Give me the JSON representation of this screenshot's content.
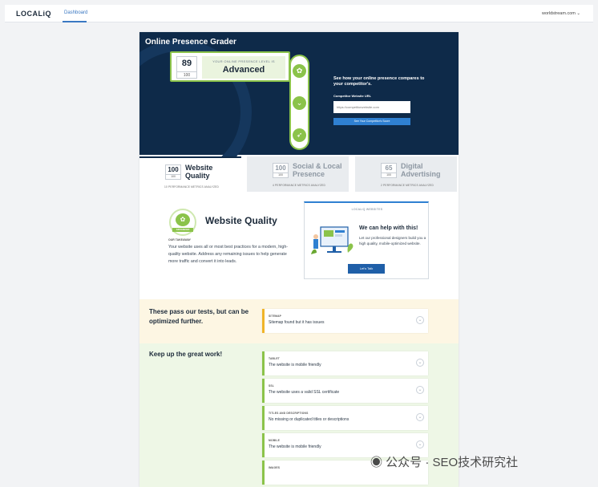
{
  "topbar": {
    "logo": "LOCALiQ",
    "nav_tab": "Dashboard",
    "account": "worldstream.com"
  },
  "hero": {
    "title": "Online Presence Grader",
    "score": "89",
    "score_out_of": "100",
    "level_caption": "YOUR ONLINE PRESENCE LEVEL IS",
    "level": "Advanced",
    "compare_text": "See how your online presence compares to your competitor's.",
    "url_label": "Competitor Website URL",
    "url_placeholder": "https://competitorwebsite.com",
    "compare_button": "See Your Competitor's Score"
  },
  "categories": [
    {
      "score": "100",
      "out_of": "100",
      "name": "Website Quality",
      "metrics": "10 PERFORMANCE METRICS ANALYZED"
    },
    {
      "score": "100",
      "out_of": "100",
      "name": "Social & Local Presence",
      "metrics": "4 PERFORMANCE METRICS ANALYZED"
    },
    {
      "score": "65",
      "out_of": "100",
      "name": "Digital Advertising",
      "metrics": "2 PERFORMANCE METRICS ANALYZED"
    }
  ],
  "website_quality": {
    "badge": "ADVANCED",
    "title": "Website Quality",
    "caption": "OUR TAKEAWAY",
    "description": "Your website uses all or most best practices for a modern, high-quality website. Address any remaining issues to help generate more traffic and convert it into leads."
  },
  "promo": {
    "caption": "LOCALiQ WEBSITES",
    "headline": "We can help with this!",
    "text": "Let our professional designers build you a high quality, mobile-optimized website.",
    "button": "Let's Talk"
  },
  "optimize": {
    "title": "These pass our tests, but can be optimized further.",
    "items": [
      {
        "category": "SITEMAP",
        "text": "Sitemap found but it has issues"
      }
    ]
  },
  "good": {
    "title": "Keep up the great work!",
    "items": [
      {
        "category": "TABLET",
        "text": "The website is mobile friendly"
      },
      {
        "category": "SSL",
        "text": "The website uses a valid SSL certificate"
      },
      {
        "category": "TITLES AND DESCRIPTIONS",
        "text": "No missing or duplicated titles or descriptions"
      },
      {
        "category": "MOBILE",
        "text": "The website is mobile friendly"
      },
      {
        "category": "IMAGES",
        "text": ""
      }
    ]
  },
  "watermark": "公众号 · SEO技术研究社"
}
